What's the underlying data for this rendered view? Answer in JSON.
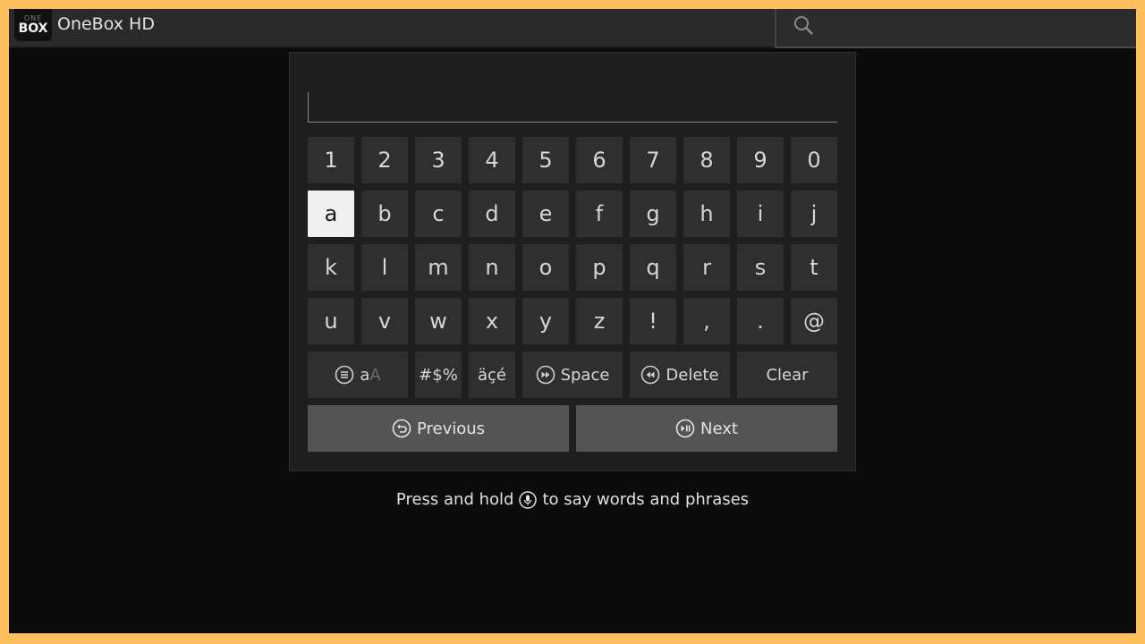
{
  "app": {
    "logo_top": "ONE",
    "logo_bottom": "BOX",
    "title": "OneBox HD"
  },
  "search": {
    "icon": "search-icon"
  },
  "text_field": {
    "value": ""
  },
  "keyboard": {
    "row1": [
      "1",
      "2",
      "3",
      "4",
      "5",
      "6",
      "7",
      "8",
      "9",
      "0"
    ],
    "row2": [
      "a",
      "b",
      "c",
      "d",
      "e",
      "f",
      "g",
      "h",
      "i",
      "j"
    ],
    "row3": [
      "k",
      "l",
      "m",
      "n",
      "o",
      "p",
      "q",
      "r",
      "s",
      "t"
    ],
    "row4": [
      "u",
      "v",
      "w",
      "x",
      "y",
      "z",
      "!",
      ",",
      ".",
      "@"
    ],
    "selected_key": "a",
    "case_toggle": {
      "small": "a",
      "big": "A"
    },
    "symbols_label": "#$%",
    "accents_label": "äçé",
    "space_label": "Space",
    "delete_label": "Delete",
    "clear_label": "Clear",
    "previous_label": "Previous",
    "next_label": "Next"
  },
  "hint": {
    "before": "Press and hold",
    "after": "to say words and phrases"
  }
}
